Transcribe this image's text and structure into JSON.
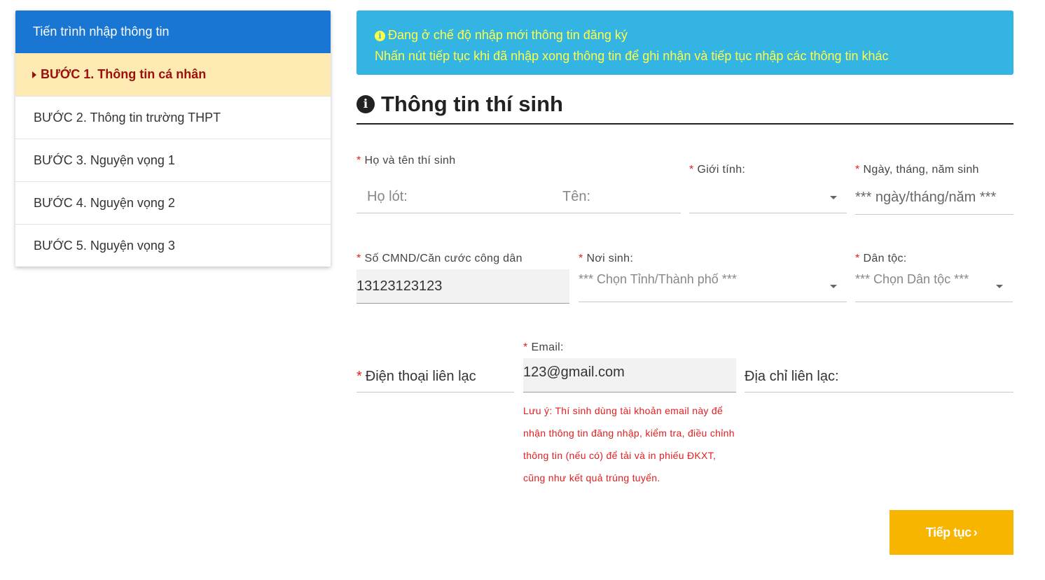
{
  "sidebar": {
    "title": "Tiến trình nhập thông tin",
    "steps": [
      {
        "label": "BƯỚC 1. Thông tin cá nhân"
      },
      {
        "label": "BƯỚC 2. Thông tin trường THPT"
      },
      {
        "label": "BƯỚC 3. Nguyện vọng 1"
      },
      {
        "label": "BƯỚC 4. Nguyện vọng 2"
      },
      {
        "label": "BƯỚC 5. Nguyện vọng 3"
      }
    ]
  },
  "alert": {
    "line1": "Đang ở chế độ nhập mới thông tin đăng ký",
    "line2": "Nhấn nút tiếp tục khi đã nhập xong thông tin để ghi nhận và tiếp tục nhập các thông tin khác"
  },
  "section": {
    "title": "Thông tin thí sinh"
  },
  "form": {
    "required_mark": "*",
    "fullname_label": "Họ và tên thí sinh",
    "middlename_placeholder": "Họ lót:",
    "firstname_placeholder": "Tên:",
    "gender_label": "Giới tính:",
    "gender_value": "",
    "dob_label": "Ngày, tháng, năm sinh",
    "dob_placeholder": "*** ngày/tháng/năm ***",
    "id_label": "Số CMND/Căn cước công dân",
    "id_value": "13123123123",
    "birthplace_label": "Nơi sinh:",
    "birthplace_placeholder": "*** Chọn Tỉnh/Thành phố ***",
    "ethnicity_label": "Dân tộc:",
    "ethnicity_placeholder": "*** Chọn Dân tộc ***",
    "phone_placeholder": "Điện thoại liên lạc",
    "email_label": "Email:",
    "email_value": "123@gmail.com",
    "address_placeholder": "Địa chỉ liên lạc:",
    "email_note": "Lưu ý: Thí sinh dùng tài khoản email này để nhận thông tin đăng nhập, kiểm tra, điều chỉnh thông tin (nếu có) để tải và in phiếu ĐKXT, cũng như kết quả trúng tuyển."
  },
  "buttons": {
    "next_label": "Tiếp tục",
    "next_icon": "chevron-right-icon"
  },
  "colors": {
    "sidebar_header": "#1976d2",
    "active_step_bg": "#fdebb3",
    "active_step_text": "#9b0f0f",
    "alert_bg": "#34b4e3",
    "alert_text": "#ffff4a",
    "required": "#e02020",
    "next_button": "#f7b500"
  }
}
